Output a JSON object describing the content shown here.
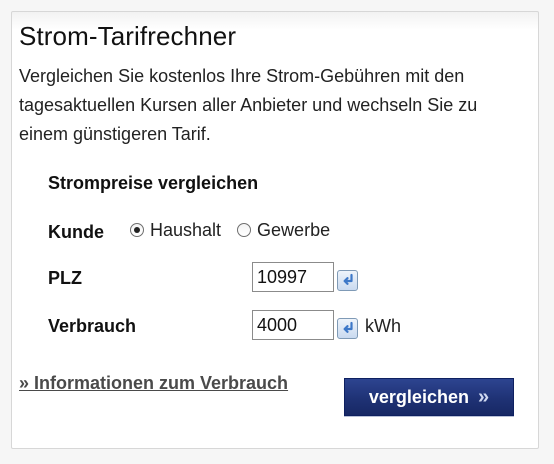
{
  "header": {
    "title": "Strom-Tarifrechner",
    "description": "Vergleichen Sie kostenlos Ihre Strom-Gebühren mit den tagesaktuellen Kursen aller Anbieter und wechseln Sie zu einem günstigeren Tarif."
  },
  "form": {
    "heading": "Strompreise vergleichen",
    "kunde": {
      "label": "Kunde",
      "options": [
        {
          "label": "Haushalt",
          "checked": true
        },
        {
          "label": "Gewerbe",
          "checked": false
        }
      ]
    },
    "plz": {
      "label": "PLZ",
      "value": "10997"
    },
    "verbrauch": {
      "label": "Verbrauch",
      "value": "4000",
      "unit": "kWh"
    }
  },
  "footer": {
    "info_link": "» Informationen zum Verbrauch",
    "submit_label": "vergleichen",
    "submit_arrow": "»"
  },
  "colors": {
    "button": "#1f3275",
    "link": "#4a4a4a",
    "enter_icon": "#3d78c8"
  },
  "icons": {
    "enter": "return-arrow-icon"
  }
}
